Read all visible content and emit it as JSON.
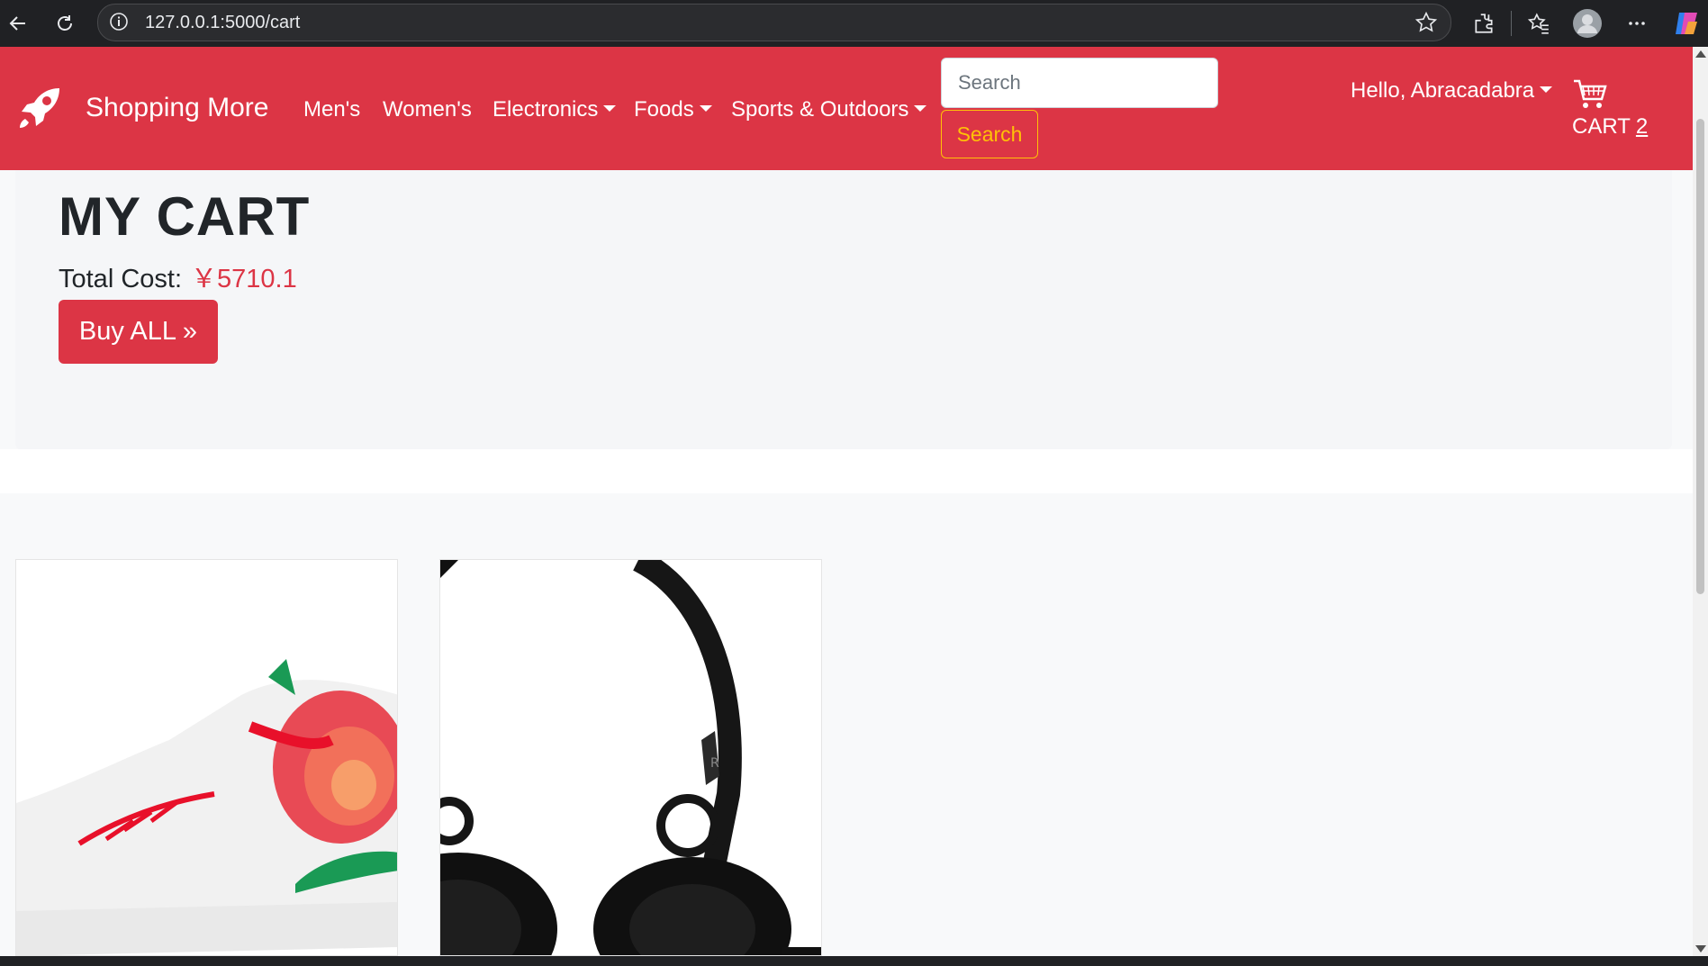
{
  "browser": {
    "url": "127.0.0.1:5000/cart"
  },
  "navbar": {
    "brand": "Shopping More",
    "links": [
      "Men's",
      "Women's",
      "Electronics",
      "Foods",
      "Sports & Outdoors"
    ],
    "search_placeholder": "Search",
    "search_button": "Search",
    "user_greeting": "Hello, Abracadabra",
    "cart_label": "CART",
    "cart_count": "2"
  },
  "cart": {
    "title": "MY CART",
    "total_label": "Total Cost:",
    "total_value": "￥5710.1",
    "buy_all_button": "Buy ALL »"
  },
  "products": [
    {
      "image": "sneaker-image"
    },
    {
      "image": "headphones-image"
    }
  ],
  "colors": {
    "navbar": "#dc3545",
    "search_button": "#ffc107",
    "price": "#dc3545"
  }
}
